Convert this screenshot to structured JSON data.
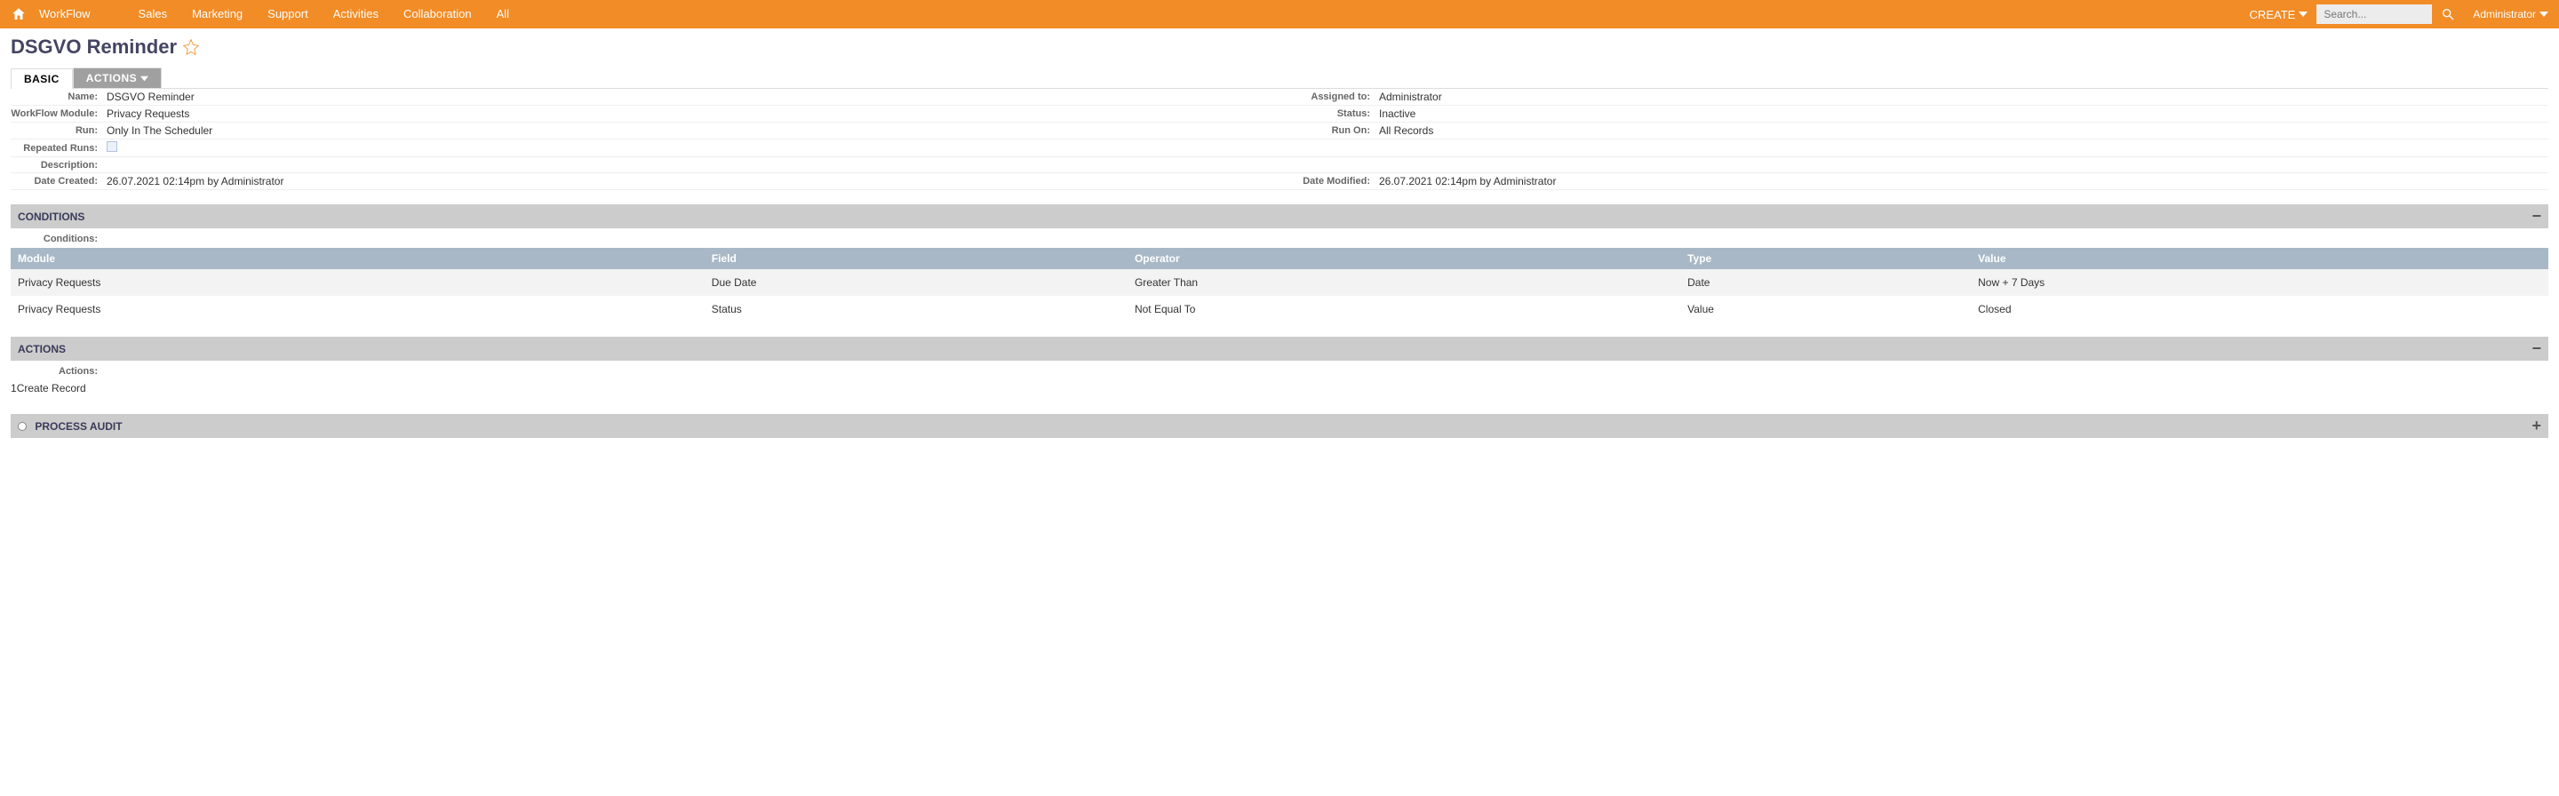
{
  "nav": {
    "workflow_label": "WorkFlow",
    "items": [
      "Sales",
      "Marketing",
      "Support",
      "Activities",
      "Collaboration",
      "All"
    ],
    "create_label": "CREATE",
    "search_placeholder": "Search...",
    "admin_label": "Administrator"
  },
  "page": {
    "title": "DSGVO Reminder"
  },
  "tabs": {
    "basic": "BASIC",
    "actions": "ACTIONS"
  },
  "details": {
    "labels": {
      "name": "Name:",
      "assigned_to": "Assigned to:",
      "workflow_module": "WorkFlow Module:",
      "status": "Status:",
      "run": "Run:",
      "run_on": "Run On:",
      "repeated_runs": "Repeated Runs:",
      "description": "Description:",
      "date_created": "Date Created:",
      "date_modified": "Date Modified:"
    },
    "values": {
      "name": "DSGVO Reminder",
      "assigned_to": "Administrator",
      "workflow_module": "Privacy Requests",
      "status": "Inactive",
      "run": "Only In The Scheduler",
      "run_on": "All Records",
      "description": "",
      "date_created": "26.07.2021 02:14pm by Administrator",
      "date_modified": "26.07.2021 02:14pm by Administrator"
    }
  },
  "sections": {
    "conditions_title": "CONDITIONS",
    "actions_title": "ACTIONS",
    "process_audit_title": "PROCESS AUDIT",
    "conditions_sublabel": "Conditions:",
    "actions_sublabel": "Actions:"
  },
  "conditions": {
    "headers": {
      "module": "Module",
      "field": "Field",
      "operator": "Operator",
      "type": "Type",
      "value": "Value"
    },
    "rows": [
      {
        "module": "Privacy Requests",
        "field": "Due Date",
        "operator": "Greater Than",
        "type": "Date",
        "value": "Now + 7 Days"
      },
      {
        "module": "Privacy Requests",
        "field": "Status",
        "operator": "Not Equal To",
        "type": "Value",
        "value": "Closed"
      }
    ]
  },
  "actions_list": {
    "rows": [
      {
        "order": "1",
        "label": "Create Record"
      }
    ]
  }
}
